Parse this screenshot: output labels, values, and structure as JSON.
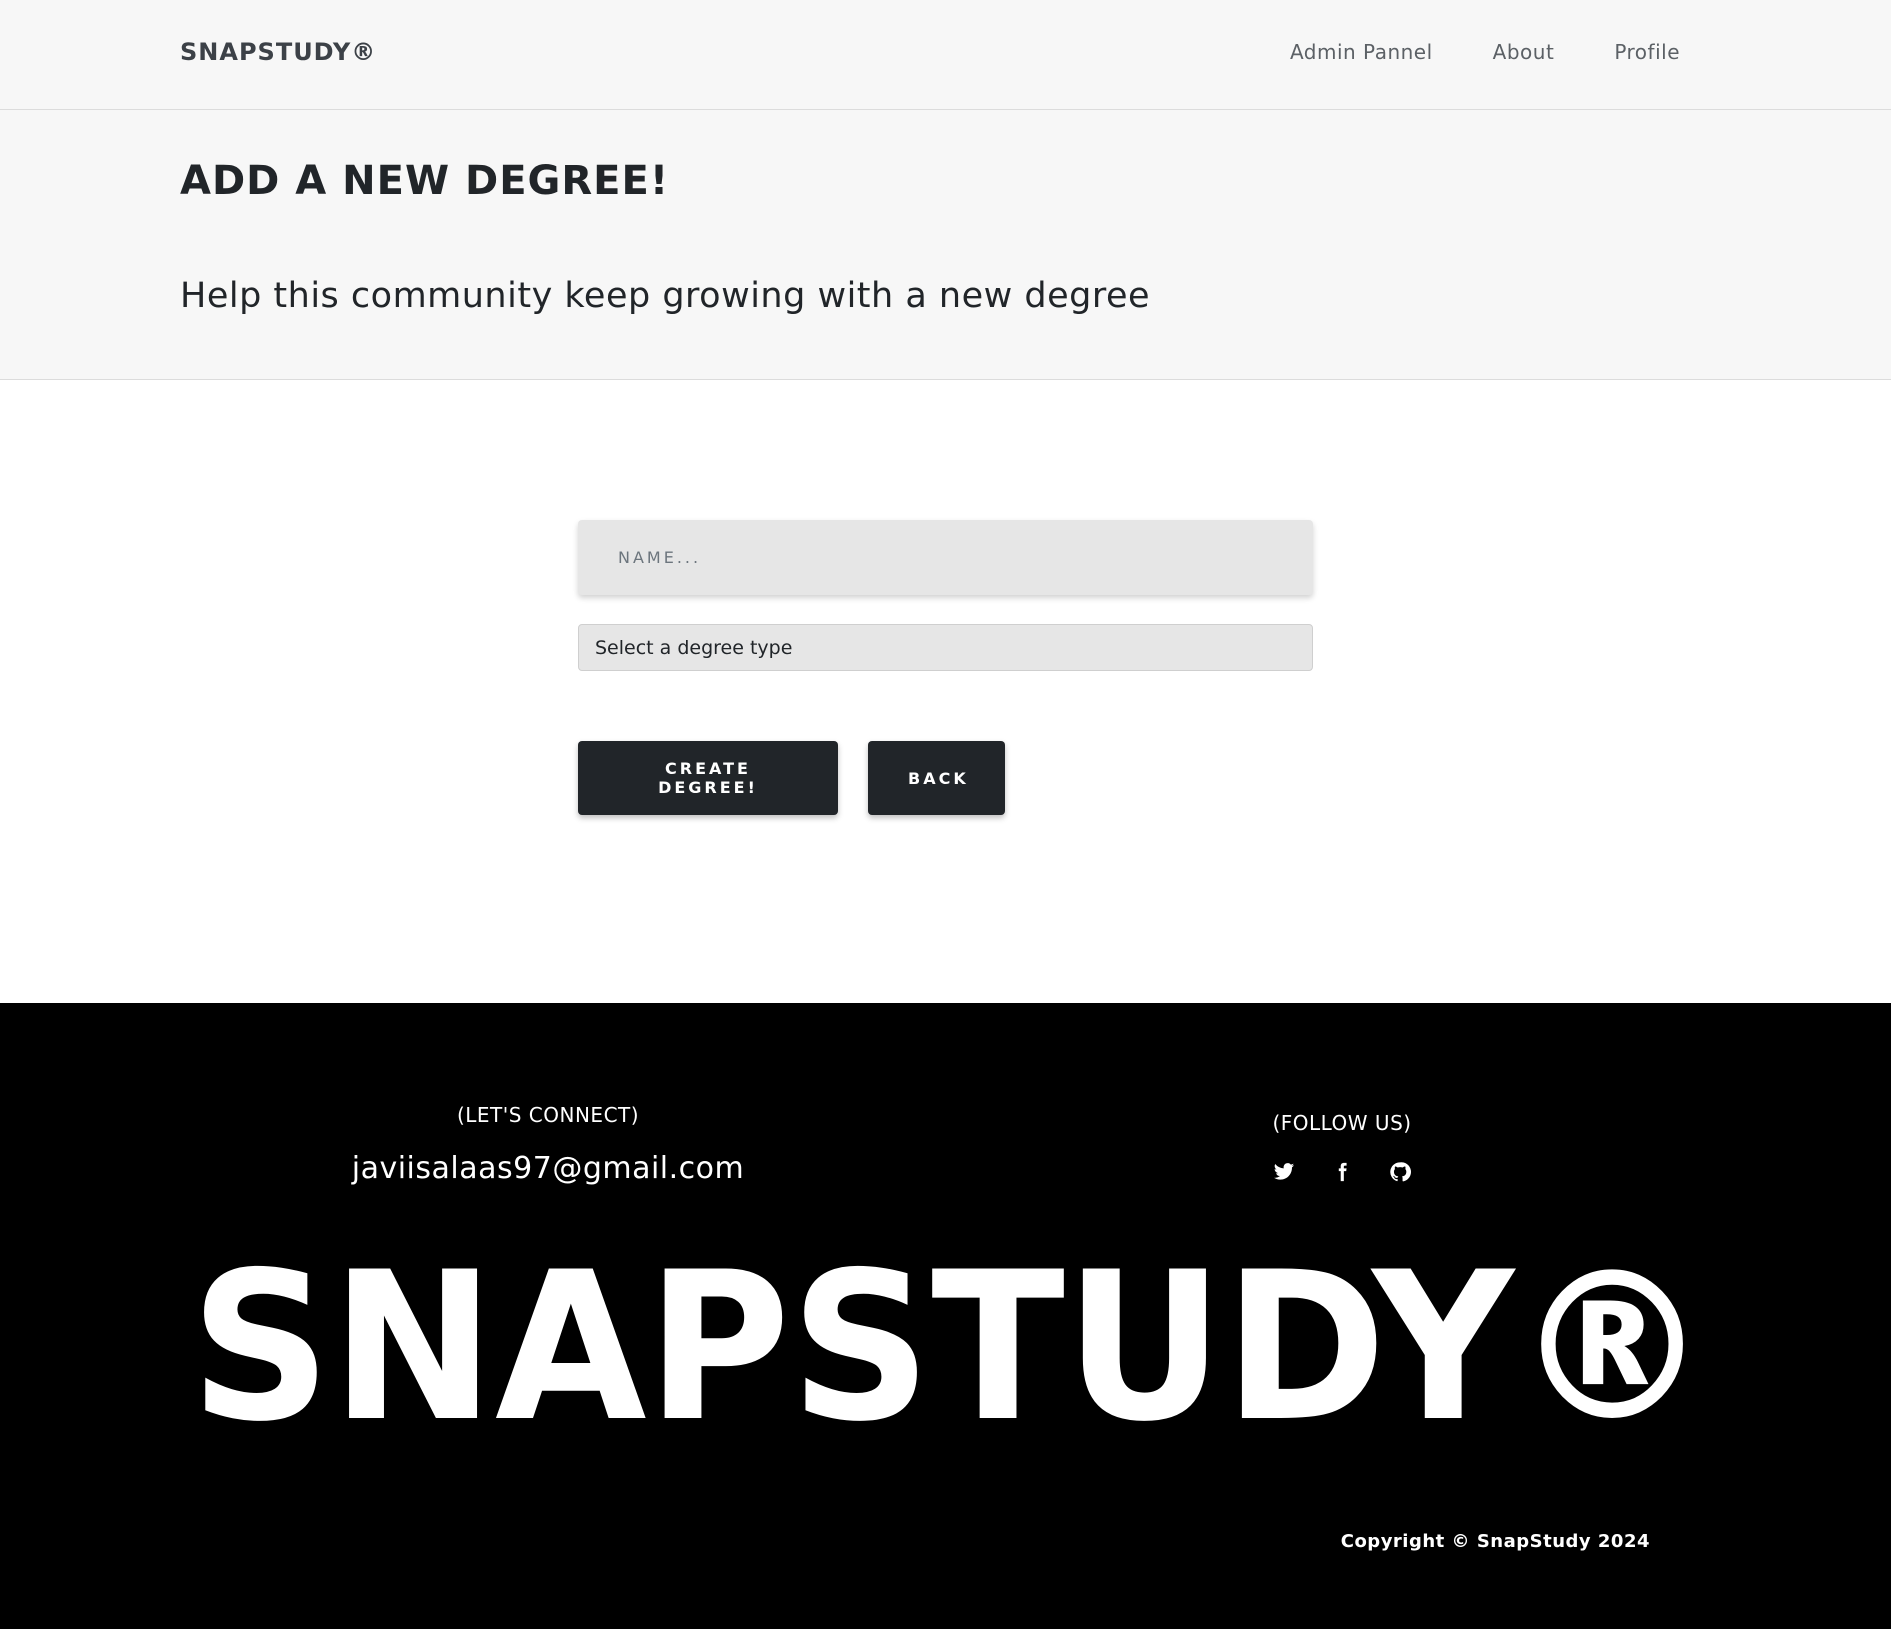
{
  "navbar": {
    "brand": "SNAPSTUDY®",
    "links": [
      {
        "label": "Admin Pannel"
      },
      {
        "label": "About"
      },
      {
        "label": "Profile"
      }
    ]
  },
  "header": {
    "title": "ADD A NEW DEGREE!",
    "subtitle": "Help this community keep growing with a new degree"
  },
  "form": {
    "name_placeholder": "NAME...",
    "degree_type_selected": "Select a degree type",
    "create_button": "CREATE DEGREE!",
    "back_button": "BACK"
  },
  "footer": {
    "connect_label": "(LET'S CONNECT)",
    "email": "javiisalaas97@gmail.com",
    "follow_label": "(FOLLOW US)",
    "social_icons": [
      "twitter-icon",
      "facebook-icon",
      "github-icon"
    ],
    "big_logo": "SNAPSTUDY®",
    "copyright": "Copyright © SnapStudy 2024"
  },
  "colors": {
    "navbar_bg": "#f7f7f7",
    "button_bg": "#212529",
    "footer_bg": "#000000",
    "input_bg": "#e6e6e6"
  }
}
